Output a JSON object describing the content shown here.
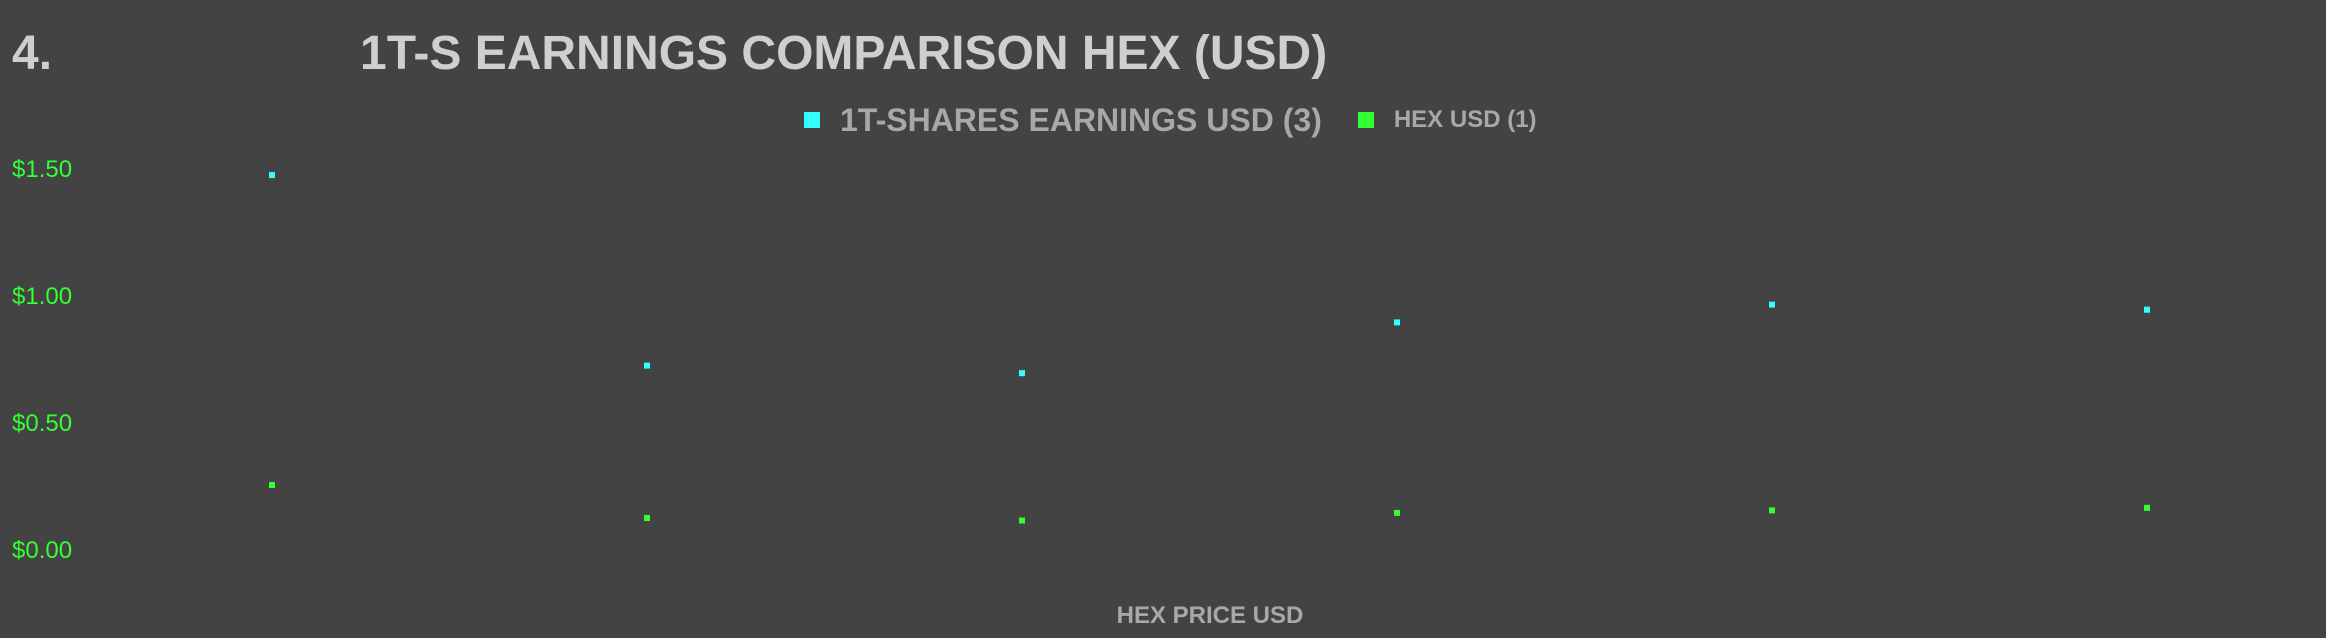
{
  "header": {
    "number": "4.",
    "title": "1T-S EARNINGS COMPARISON HEX (USD)"
  },
  "colors": {
    "background": "#434343",
    "series1": "#33ffff",
    "series2": "#33ff33",
    "text": "#a8a8a8"
  },
  "chart_data": {
    "type": "scatter",
    "title": "1T-S EARNINGS COMPARISON HEX (USD)",
    "xlabel": "HEX PRICE USD",
    "ylabel": "",
    "ylim": [
      0,
      1.5
    ],
    "yticks": [
      "$0.00",
      "$0.50",
      "$1.00",
      "$1.50"
    ],
    "grid": false,
    "legend_position": "top-center",
    "series": [
      {
        "name": "1T-SHARES  EARNINGS USD (3)",
        "color": "#33ffff",
        "values": [
          1.48,
          0.73,
          0.7,
          0.9,
          0.97,
          0.95
        ]
      },
      {
        "name": "HEX USD (1)",
        "color": "#33ff33",
        "values": [
          0.26,
          0.13,
          0.12,
          0.15,
          0.16,
          0.17
        ]
      }
    ]
  }
}
